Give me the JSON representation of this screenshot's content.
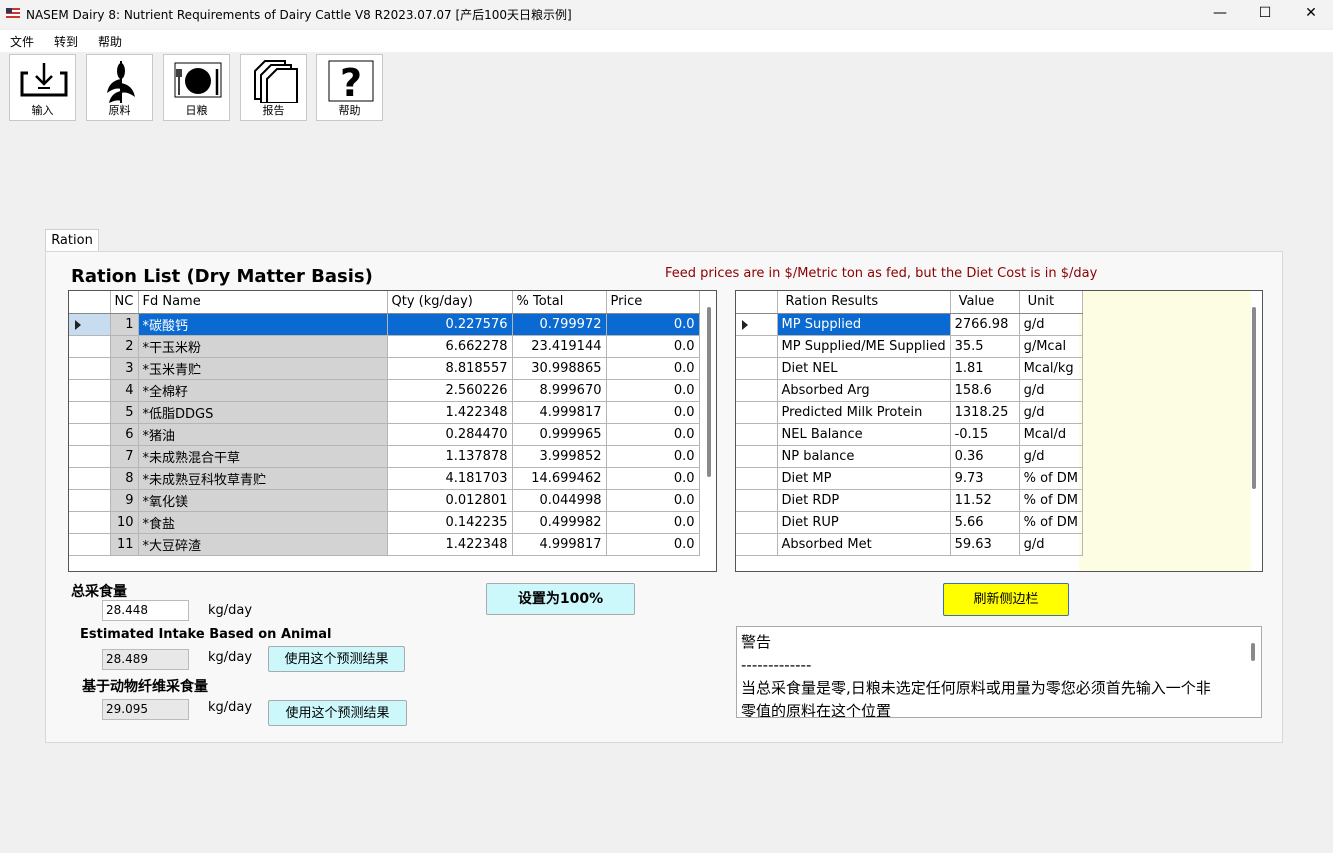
{
  "window": {
    "title": "NASEM Dairy 8: Nutrient Requirements of Dairy Cattle  V8 R2023.07.07 [产后100天日粮示例]",
    "minimize": "—",
    "maximize": "☐",
    "close": "✕"
  },
  "menu": [
    "文件",
    "转到",
    "帮助"
  ],
  "toolbar": [
    {
      "label": "输入",
      "icon": "input-icon"
    },
    {
      "label": "原料",
      "icon": "corn-icon"
    },
    {
      "label": "日粮",
      "icon": "plate-icon"
    },
    {
      "label": "报告",
      "icon": "report-icon"
    },
    {
      "label": "帮助",
      "icon": "help-icon"
    }
  ],
  "tab": {
    "label": "Ration"
  },
  "ration": {
    "heading": "Ration List (Dry Matter Basis)",
    "price_note": "Feed prices are in $/Metric ton as fed, but the Diet Cost is in $/day",
    "columns": [
      "NC",
      "Fd  Name",
      "Qty (kg/day)",
      "% Total",
      "Price"
    ],
    "rows": [
      {
        "no": "1",
        "name": "*碳酸钙",
        "qty": "0.227576",
        "pct": "0.799972",
        "price": "0.0"
      },
      {
        "no": "2",
        "name": "*干玉米粉",
        "qty": "6.662278",
        "pct": "23.419144",
        "price": "0.0"
      },
      {
        "no": "3",
        "name": "*玉米青贮",
        "qty": "8.818557",
        "pct": "30.998865",
        "price": "0.0"
      },
      {
        "no": "4",
        "name": "*全棉籽",
        "qty": "2.560226",
        "pct": "8.999670",
        "price": "0.0"
      },
      {
        "no": "5",
        "name": "*低脂DDGS",
        "qty": "1.422348",
        "pct": "4.999817",
        "price": "0.0"
      },
      {
        "no": "6",
        "name": "*猪油",
        "qty": "0.284470",
        "pct": "0.999965",
        "price": "0.0"
      },
      {
        "no": "7",
        "name": "*未成熟混合干草",
        "qty": "1.137878",
        "pct": "3.999852",
        "price": "0.0"
      },
      {
        "no": "8",
        "name": "*未成熟豆科牧草青贮",
        "qty": "4.181703",
        "pct": "14.699462",
        "price": "0.0"
      },
      {
        "no": "9",
        "name": "*氧化镁",
        "qty": "0.012801",
        "pct": "0.044998",
        "price": "0.0"
      },
      {
        "no": "10",
        "name": "*食盐",
        "qty": "0.142235",
        "pct": "0.499982",
        "price": "0.0"
      },
      {
        "no": "11",
        "name": "*大豆碎渣",
        "qty": "1.422348",
        "pct": "4.999817",
        "price": "0.0"
      }
    ]
  },
  "results": {
    "columns": [
      "Ration Results",
      "Value",
      "Unit"
    ],
    "rows": [
      {
        "name": "MP Supplied",
        "value": "2766.98",
        "unit": "g/d"
      },
      {
        "name": "MP Supplied/ME Supplied",
        "value": "35.5",
        "unit": "g/Mcal"
      },
      {
        "name": "Diet NEL",
        "value": "1.81",
        "unit": "Mcal/kg"
      },
      {
        "name": "Absorbed Arg",
        "value": "158.6",
        "unit": "g/d"
      },
      {
        "name": "Predicted Milk Protein",
        "value": "1318.25",
        "unit": "g/d"
      },
      {
        "name": "NEL Balance",
        "value": "-0.15",
        "unit": "Mcal/d"
      },
      {
        "name": "NP balance",
        "value": "0.36",
        "unit": "g/d"
      },
      {
        "name": "Diet MP",
        "value": "9.73",
        "unit": "% of DM"
      },
      {
        "name": "Diet RDP",
        "value": "11.52",
        "unit": "% of DM"
      },
      {
        "name": "Diet RUP",
        "value": "5.66",
        "unit": "% of DM"
      },
      {
        "name": "Absorbed Met",
        "value": "59.63",
        "unit": "g/d"
      }
    ]
  },
  "intake": {
    "total_label": "总采食量",
    "total_value": "28.448",
    "total_unit": "kg/day",
    "est_label": "Estimated Intake Based on Animal",
    "est_value": "28.489",
    "est_unit": "kg/day",
    "est_button": "使用这个预测结果",
    "fiber_label": "基于动物纤维采食量",
    "fiber_value": "29.095",
    "fiber_unit": "kg/day",
    "fiber_button": "使用这个预测结果"
  },
  "buttons": {
    "set100": "设置为100%",
    "refresh": "刷新侧边栏"
  },
  "warning": {
    "title": "警告",
    "divider": "-------------",
    "line1": "当总采食量是零,日粮未选定任何原料或用量为零您必须首先输入一个非",
    "line2": "零值的原料在这个位置"
  }
}
